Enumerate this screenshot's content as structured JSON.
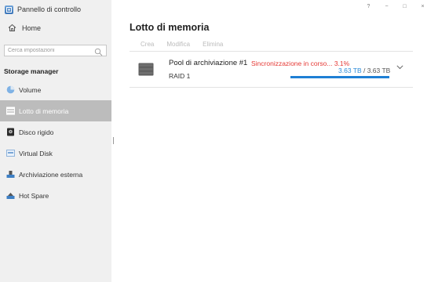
{
  "window": {
    "help": "?",
    "minimize": "−",
    "maximize": "□",
    "close": "×"
  },
  "sidebar": {
    "app_title": "Pannello di controllo",
    "home": "Home",
    "search_placeholder": "Cerca impostazioni",
    "section": "Storage manager",
    "items": [
      {
        "label": "Volume",
        "icon": "volume-icon"
      },
      {
        "label": "Lotto di memoria",
        "icon": "storage-pool-icon",
        "active": true
      },
      {
        "label": "Disco rigido",
        "icon": "hard-disk-icon"
      },
      {
        "label": "Virtual Disk",
        "icon": "virtual-disk-icon"
      },
      {
        "label": "Archiviazione esterna",
        "icon": "external-storage-icon"
      },
      {
        "label": "Hot Spare",
        "icon": "hot-spare-icon"
      }
    ]
  },
  "main": {
    "title": "Lotto di memoria",
    "toolbar": {
      "create": "Crea",
      "modify": "Modifica",
      "delete": "Elimina"
    },
    "pool": {
      "name": "Pool di archiviazione #1",
      "status": "Sincronizzazione in corso... 3.1%",
      "raid": "RAID 1",
      "used": "3.63 TB",
      "separator": " / ",
      "total": "3.63 TB",
      "usage_fraction": 1.0
    }
  },
  "colors": {
    "accent": "#1e7fd4",
    "status_error": "#e53935",
    "sidebar_active": "#bcbcbc"
  }
}
